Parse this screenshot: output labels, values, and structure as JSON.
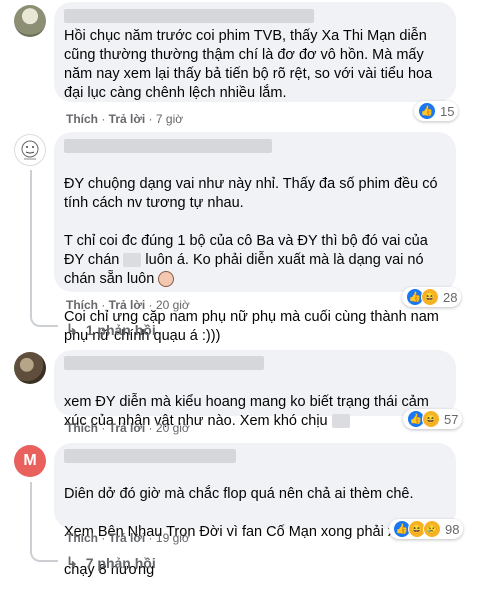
{
  "comments": [
    {
      "avatar": "landscape-photo",
      "text": "Hồi chục năm trước coi phim TVB, thấy Xa Thi Mạn diễn cũng thường thường thậm chí là đơ đơ vô hồn. Mà mấy năm nay xem lại thấy bả tiến bộ rõ rệt, so với vài tiểu hoa đại lục càng chênh lệch nhiều lắm.",
      "like": "Thích",
      "reply": "Trả lời",
      "time": "7 giờ",
      "reaction_count": "15",
      "reactions": [
        "like-icon"
      ]
    },
    {
      "avatar": "drawn-face",
      "text_1": "ĐY chuộng dạng vai như này nhỉ. Thấy đa số phim đều có tính cách nv tương tự nhau.",
      "text_2": "T chỉ coi đc đúng 1 bộ của cô Ba và ĐY thì bộ đó vai của ĐY chán",
      "text_3": "luôn á. Ko phải diễn xuất mà là dạng vai nó chán sẵn luôn",
      "text_4": "Coi chỉ ưng cặp nam phụ nữ phụ mà cuối cùng thành nam phụ nữ chính quạu á :)))",
      "like": "Thích",
      "reply": "Trả lời",
      "time": "20 giờ",
      "reaction_count": "28",
      "reactions": [
        "like-icon",
        "haha-icon"
      ],
      "replies_label": "1 phản hồi"
    },
    {
      "avatar": "dark-photo",
      "text": "xem ĐY diễn mà kiểu hoang mang ko biết trạng thái cảm xúc của nhân vật như nào. Xem khó chịu",
      "like": "Thích",
      "reply": "Trả lời",
      "time": "20 giờ",
      "reaction_count": "57",
      "reactions": [
        "like-icon",
        "haha-icon"
      ]
    },
    {
      "avatar_letter": "M",
      "avatar_color": "#e8615c",
      "text_1": "Diên dở đó giờ mà chắc flop quá nên chả ai thèm chê.",
      "text_2": "Xem Bên Nhau Trọn Đời vì fan Cố Mạn xong phải xách",
      "text_3": "chạy 8 hương",
      "like": "Thích",
      "reply": "Trả lời",
      "time": "19 giờ",
      "reaction_count": "98",
      "reactions": [
        "like-icon",
        "haha-icon",
        "sad-icon"
      ],
      "replies_label": "7 phản hồi"
    }
  ]
}
